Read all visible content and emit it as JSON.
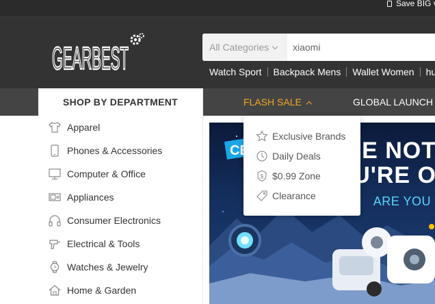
{
  "topbar": {
    "promo_text": "Save BIG v"
  },
  "brand": {
    "logo_text": "GEARBEST",
    "accent": "#f5a623"
  },
  "search": {
    "category": "All Categories",
    "query": "xiaomi"
  },
  "hot_searches": [
    "Watch Sport",
    "Backpack Mens",
    "Wallet Women",
    "hu"
  ],
  "nav": {
    "flash_sale": "FLASH SALE",
    "global_launch": "GLOBAL LAUNCH"
  },
  "department": {
    "title": "SHOP BY DEPARTMENT",
    "items": [
      {
        "label": "Apparel",
        "icon": "shirt-icon"
      },
      {
        "label": "Phones & Accessories",
        "icon": "phone-icon"
      },
      {
        "label": "Computer & Office",
        "icon": "monitor-icon"
      },
      {
        "label": "Appliances",
        "icon": "appliance-icon"
      },
      {
        "label": "Consumer Electronics",
        "icon": "headphones-icon"
      },
      {
        "label": "Electrical & Tools",
        "icon": "drill-icon"
      },
      {
        "label": "Watches & Jewelry",
        "icon": "watch-icon"
      },
      {
        "label": "Home & Garden",
        "icon": "home-icon"
      }
    ]
  },
  "flash_menu": {
    "items": [
      {
        "label": "Exclusive Brands",
        "icon": "star-icon"
      },
      {
        "label": "Daily Deals",
        "icon": "clock-icon"
      },
      {
        "label": "$0.99 Zone",
        "icon": "shield-dollar-icon"
      },
      {
        "label": "Clearance",
        "icon": "tag-icon"
      }
    ]
  },
  "banner": {
    "badge": "CE",
    "line1": "E NOT",
    "line2": "U'RE O",
    "line3": "ARE YOU"
  }
}
